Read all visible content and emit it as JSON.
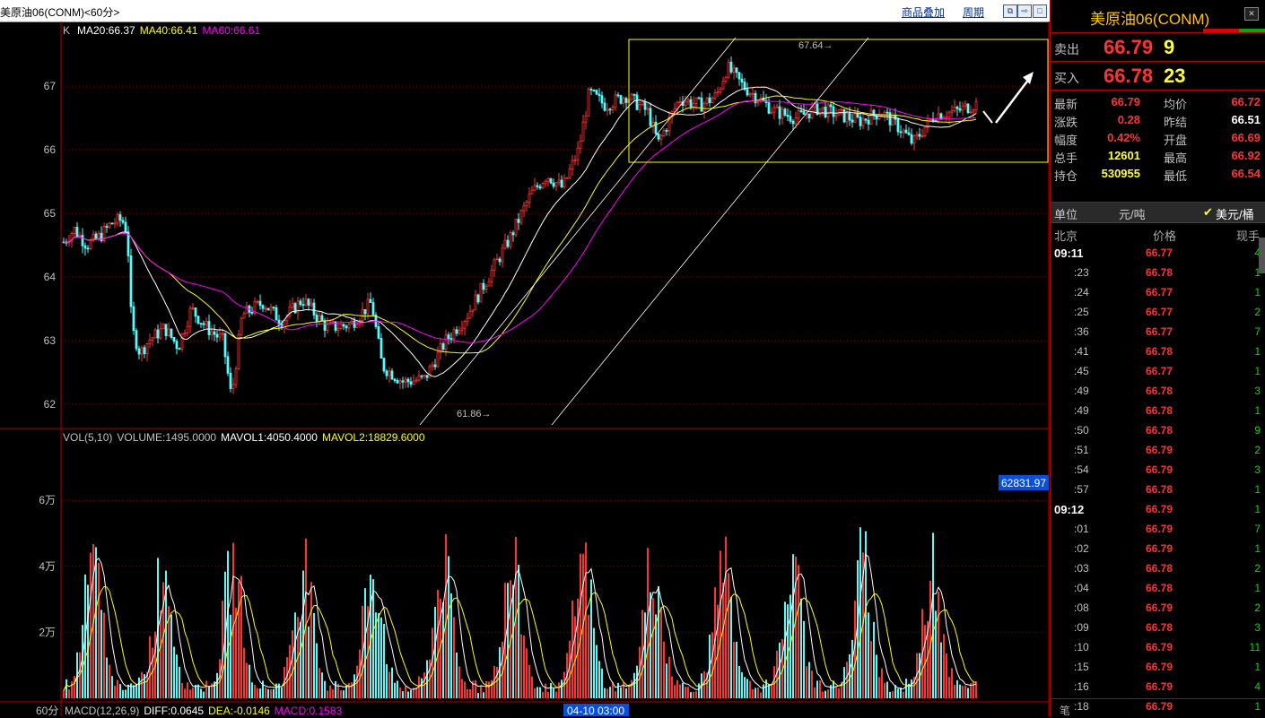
{
  "window": {
    "title": "美原油06(CONM)<60分>"
  },
  "toolbar": {
    "overlay_label": "商品叠加",
    "period_label": "周期"
  },
  "chart": {
    "k_label": "K",
    "ma_legend": [
      {
        "text": "MA20:66.37",
        "color": "#ffffff"
      },
      {
        "text": "MA40:66.41",
        "color": "#ffff00"
      },
      {
        "text": "MA60:66.61",
        "color": "#ff00ff"
      }
    ],
    "price_ticks": [
      "67",
      "66",
      "65",
      "64",
      "63",
      "62"
    ],
    "high_annotation": "67.64",
    "low_annotation": "61.86",
    "vol_legend": [
      {
        "text": "VOL(5,10)",
        "color": "#c0c0c0"
      },
      {
        "text": "VOLUME:1495.0000",
        "color": "#c0c0c0"
      },
      {
        "text": "MAVOL1:4050.4000",
        "color": "#ffffff"
      },
      {
        "text": "MAVOL2:18829.6000",
        "color": "#ffff00"
      }
    ],
    "vol_ticks": [
      "6万",
      "4万",
      "2万"
    ],
    "cursor_value": "62831.97",
    "period_tab": "60分",
    "macd_legend": [
      {
        "text": "MACD(12,26,9)",
        "color": "#c0c0c0"
      },
      {
        "text": "DIFF:0.0645",
        "color": "#ffffff"
      },
      {
        "text": "DEA:-0.0146",
        "color": "#ffff00"
      },
      {
        "text": "MACD:0.1583",
        "color": "#ff00ff"
      }
    ],
    "time_cursor": "04-10 03:00",
    "colors": {
      "up": "#ff3232",
      "down": "#54fcfc",
      "ma20": "#ffffff",
      "ma40": "#ffff00",
      "ma60": "#ff00ff",
      "box": "#ffff00"
    }
  },
  "quote": {
    "symbol": "美原油06(CONM)",
    "ask": {
      "label": "卖出",
      "price": "66.79",
      "qty": "9"
    },
    "bid": {
      "label": "买入",
      "price": "66.78",
      "qty": "23"
    },
    "stats": [
      {
        "l1": "最新",
        "v1": "66.79",
        "l2": "均价",
        "v2": "66.72",
        "c1": "#ff3232",
        "c2": "#ff3232"
      },
      {
        "l1": "涨跌",
        "v1": "0.28",
        "l2": "昨结",
        "v2": "66.51",
        "c1": "#ff3232",
        "c2": "#ffffff"
      },
      {
        "l1": "幅度",
        "v1": "0.42%",
        "l2": "开盘",
        "v2": "66.69",
        "c1": "#ff3232",
        "c2": "#ff3232"
      },
      {
        "l1": "总手",
        "v1": "12601",
        "l2": "最高",
        "v2": "66.92",
        "c1": "#ffff33",
        "c2": "#ff3232"
      },
      {
        "l1": "持仓",
        "v1": "530955",
        "l2": "最低",
        "v2": "66.54",
        "c1": "#ffff33",
        "c2": "#ff3232"
      }
    ],
    "unit_label": "单位",
    "unit_ton": "元/吨",
    "unit_barrel": "美元/桶",
    "unit_check": "✔",
    "table_headers": {
      "place": "北京",
      "price": "价格",
      "qty": "现手"
    },
    "ticks": [
      {
        "time": "09:11",
        "price": "66.77",
        "qty": "4",
        "big": true
      },
      {
        "time": ":23",
        "price": "66.78",
        "qty": "1"
      },
      {
        "time": ":24",
        "price": "66.77",
        "qty": "1"
      },
      {
        "time": ":25",
        "price": "66.77",
        "qty": "2"
      },
      {
        "time": ":36",
        "price": "66.77",
        "qty": "7"
      },
      {
        "time": ":41",
        "price": "66.78",
        "qty": "1"
      },
      {
        "time": ":45",
        "price": "66.77",
        "qty": "1"
      },
      {
        "time": ":49",
        "price": "66.78",
        "qty": "3"
      },
      {
        "time": ":49",
        "price": "66.78",
        "qty": "1"
      },
      {
        "time": ":50",
        "price": "66.78",
        "qty": "9"
      },
      {
        "time": ":51",
        "price": "66.79",
        "qty": "2"
      },
      {
        "time": ":54",
        "price": "66.79",
        "qty": "3"
      },
      {
        "time": ":57",
        "price": "66.78",
        "qty": "1"
      },
      {
        "time": "09:12",
        "price": "66.79",
        "qty": "1",
        "big": true
      },
      {
        "time": ":01",
        "price": "66.79",
        "qty": "7"
      },
      {
        "time": ":02",
        "price": "66.79",
        "qty": "1"
      },
      {
        "time": ":03",
        "price": "66.78",
        "qty": "2"
      },
      {
        "time": ":04",
        "price": "66.78",
        "qty": "1"
      },
      {
        "time": ":08",
        "price": "66.79",
        "qty": "2"
      },
      {
        "time": ":09",
        "price": "66.78",
        "qty": "3"
      },
      {
        "time": ":10",
        "price": "66.79",
        "qty": "11"
      },
      {
        "time": ":15",
        "price": "66.79",
        "qty": "1"
      },
      {
        "time": ":16",
        "price": "66.79",
        "qty": "4"
      },
      {
        "time": ":18",
        "price": "66.79",
        "qty": "1"
      }
    ],
    "bottom_tab": "笔"
  }
}
